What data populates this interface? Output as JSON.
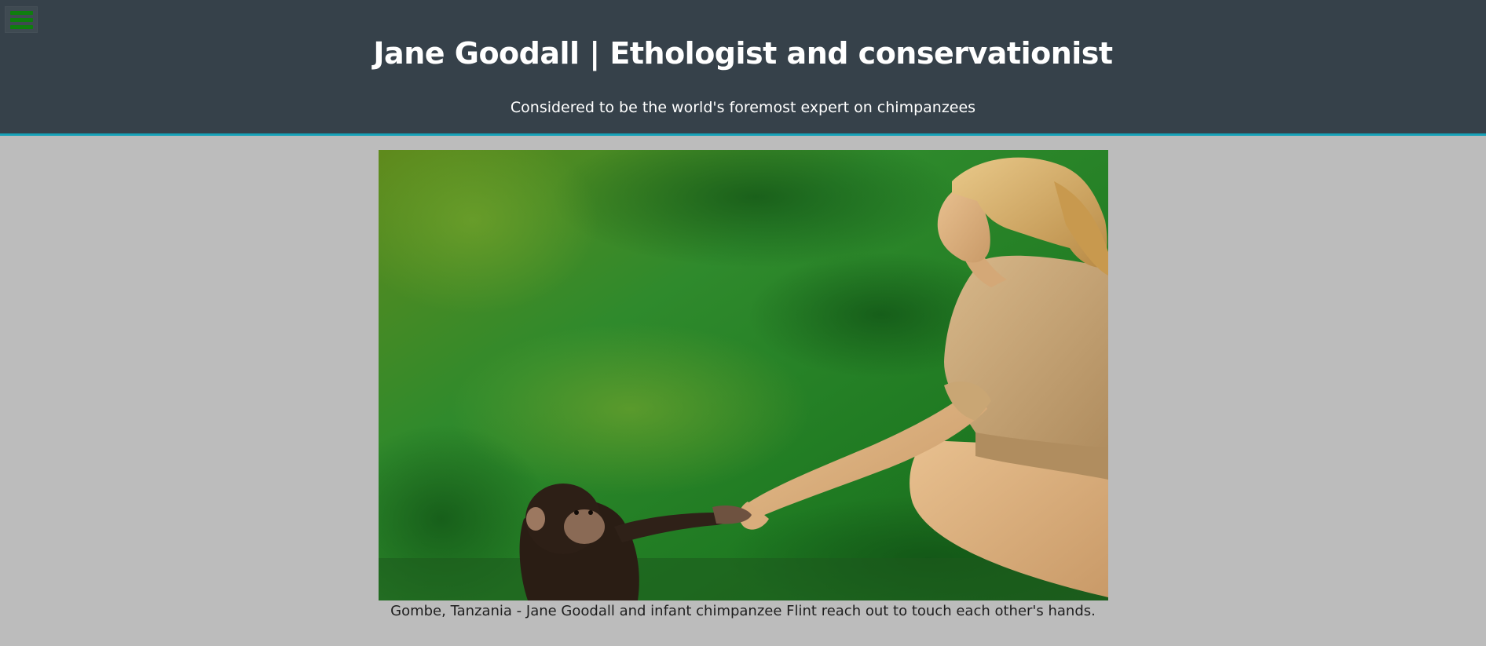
{
  "header": {
    "title": "Jane Goodall | Ethologist and conservationist",
    "subtitle": "Considered to be the world's foremost expert on chimpanzees",
    "background_color": "#36414a",
    "accent_border_color": "#17a2b8"
  },
  "menu": {
    "icon": "hamburger-menu-icon",
    "icon_color": "#0f7d0f"
  },
  "figure": {
    "image_alt": "Jane Goodall and infant chimpanzee Flint reaching out to touch hands",
    "caption": "Gombe, Tanzania - Jane Goodall and infant chimpanzee Flint reach out to touch each other's hands."
  },
  "page": {
    "background_color": "#bcbcbc"
  }
}
